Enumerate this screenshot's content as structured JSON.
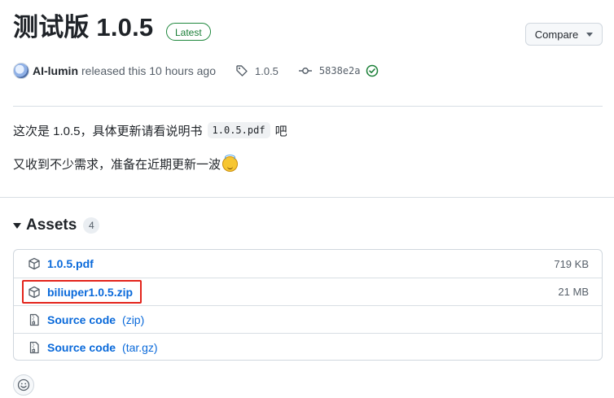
{
  "release": {
    "title": "测试版 1.0.5",
    "badge": "Latest",
    "compare_label": "Compare",
    "author": "AI-lumin",
    "released_text": "released this 10 hours ago",
    "tag": "1.0.5",
    "commit": "5838e2a"
  },
  "notes": {
    "line1_before": "这次是 1.0.5，具体更新请看说明书",
    "line1_code": "1.0.5.pdf",
    "line1_after": "吧",
    "line2": "又收到不少需求，准备在近期更新一波"
  },
  "assets": {
    "heading": "Assets",
    "count": "4",
    "items": [
      {
        "name": "1.0.5.pdf",
        "sub": "",
        "size": "719 KB",
        "icon": "package-icon"
      },
      {
        "name": "biliuper1.0.5.zip",
        "sub": "",
        "size": "21 MB",
        "icon": "package-icon"
      },
      {
        "name": "Source code",
        "sub": "(zip)",
        "size": "",
        "icon": "file-zip-icon"
      },
      {
        "name": "Source code",
        "sub": "(tar.gz)",
        "size": "",
        "icon": "file-zip-icon"
      }
    ]
  },
  "colors": {
    "link": "#0969da",
    "latest_green": "#1a7f37",
    "highlight_red": "#e3241b"
  }
}
